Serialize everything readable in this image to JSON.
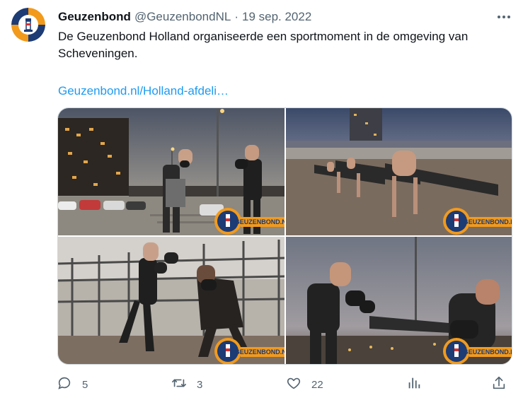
{
  "tweet": {
    "display_name": "Geuzenbond",
    "handle": "@GeuzenbondNL",
    "separator": "·",
    "date": "19 sep. 2022",
    "text": "De Geuzenbond Holland organiseerde een sportmoment in de omgeving van Scheveningen.",
    "link": "Geuzenbond.nl/Holland-afdeli…"
  },
  "media": {
    "watermark": "GEUZENBOND.NL",
    "photos": [
      {
        "scene": "boxing-sparring-street-night"
      },
      {
        "scene": "push-ups-boulevard-dusk"
      },
      {
        "scene": "boxing-sparring-balcony"
      },
      {
        "scene": "kick-pads-beach-dusk"
      }
    ]
  },
  "actions": {
    "replies": "5",
    "retweets": "3",
    "likes": "22",
    "stats": "",
    "share": ""
  },
  "icons": {
    "avatar": "geuzenbond-lighthouse-logo",
    "more": "more-dots-icon",
    "reply": "reply-icon",
    "retweet": "retweet-icon",
    "like": "heart-icon",
    "stats": "stats-icon",
    "share": "share-icon"
  },
  "colors": {
    "text": "#0f1419",
    "secondary": "#536471",
    "link": "#1d9bf0",
    "border": "#cfd9de",
    "brand_orange": "#f29a1c",
    "brand_navy": "#1d3b74"
  }
}
